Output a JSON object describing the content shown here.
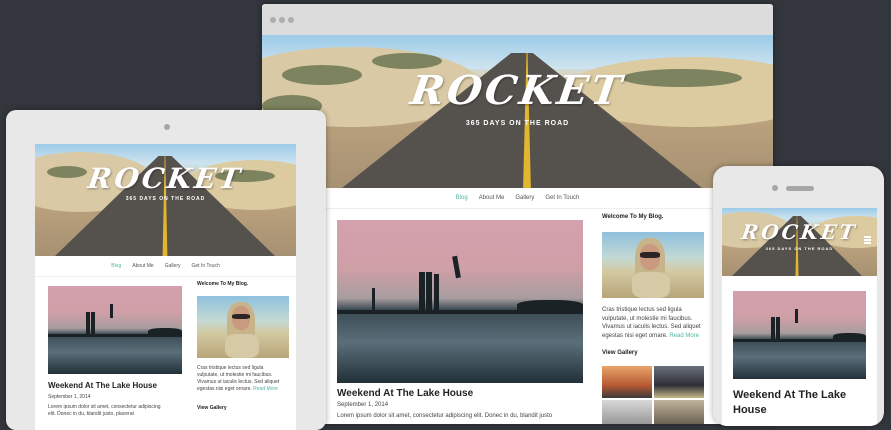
{
  "site": {
    "logo": "ROCKET",
    "tagline": "365 DAYS ON THE ROAD"
  },
  "nav": {
    "items": [
      "Blog",
      "About Me",
      "Gallery",
      "Get In Touch"
    ],
    "active": "Blog"
  },
  "post": {
    "title": "Weekend At The Lake House",
    "date": "September 1, 2014",
    "excerpt_desktop": "Lorem ipsum dolor sit amet, consectetur adipiscing elit. Donec in du, blandit justo",
    "excerpt_tablet_1": "Lorem ipsum dolor sit amet, consectetur adipiscing",
    "excerpt_tablet_2": "elit. Donec in du, blandit justo, placerat"
  },
  "sidebar": {
    "welcome_title": "Welcome To My Blog.",
    "about_text": "Cras tristique lectus sed ligula vulputate, ut molestie mi faucibus. Vivamus ut iaculis lectus. Sed aliquet egestas nisi eget ornare.",
    "about_line1": "Cras tristique lectus sed ligula",
    "about_line2": "vulputate, ut molestie mi faucibus.",
    "about_line3": "Vivamus ut iaculis lectus. Sed aliquet",
    "about_line4": "egestas nisi eget ornare.",
    "read_more": "Read More",
    "gallery_title": "View Gallery"
  },
  "colors": {
    "background": "#33363d",
    "accent": "#4fb7a0",
    "device_frame": "#e6e6e6"
  }
}
